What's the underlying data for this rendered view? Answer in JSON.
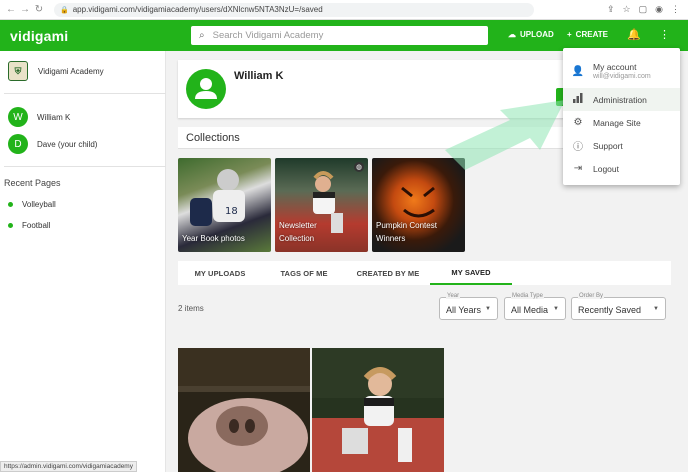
{
  "browser": {
    "url": "app.vidigami.com/vidigamiacademy/users/dXNlcnw5NTA3NzU=/saved"
  },
  "header": {
    "logo": "vidigami",
    "search_placeholder": "Search Vidigami Academy",
    "upload_label": "UPLOAD",
    "create_label": "CREATE",
    "brand_color": "#22b31a"
  },
  "sidebar": {
    "org_name": "Vidigami Academy",
    "users": [
      {
        "initial": "W",
        "name": "William K"
      },
      {
        "initial": "D",
        "name": "Dave (your child)"
      }
    ],
    "recent_title": "Recent Pages",
    "recent_pages": [
      "Volleyball",
      "Football"
    ]
  },
  "profile": {
    "name": "William K"
  },
  "collections": {
    "title": "Collections",
    "items": [
      {
        "label": "Year Book photos"
      },
      {
        "label": "Newsletter Collection"
      },
      {
        "label": "Pumpkin Contest Winners"
      }
    ]
  },
  "tabs": [
    {
      "label": "MY UPLOADS",
      "active": false
    },
    {
      "label": "TAGS OF ME",
      "active": false
    },
    {
      "label": "CREATED BY ME",
      "active": false
    },
    {
      "label": "MY SAVED",
      "active": true
    }
  ],
  "items_count": "2 items",
  "filters": [
    {
      "label": "Year",
      "value": "All Years"
    },
    {
      "label": "Media Type",
      "value": "All Media"
    },
    {
      "label": "Order By",
      "value": "Recently Saved"
    }
  ],
  "dropdown": {
    "account_label": "My account",
    "account_email": "will@vidigami.com",
    "items": [
      "Administration",
      "Manage Site",
      "Support",
      "Logout"
    ]
  },
  "status_url": "https://admin.vidigami.com/vidigamiacademy"
}
